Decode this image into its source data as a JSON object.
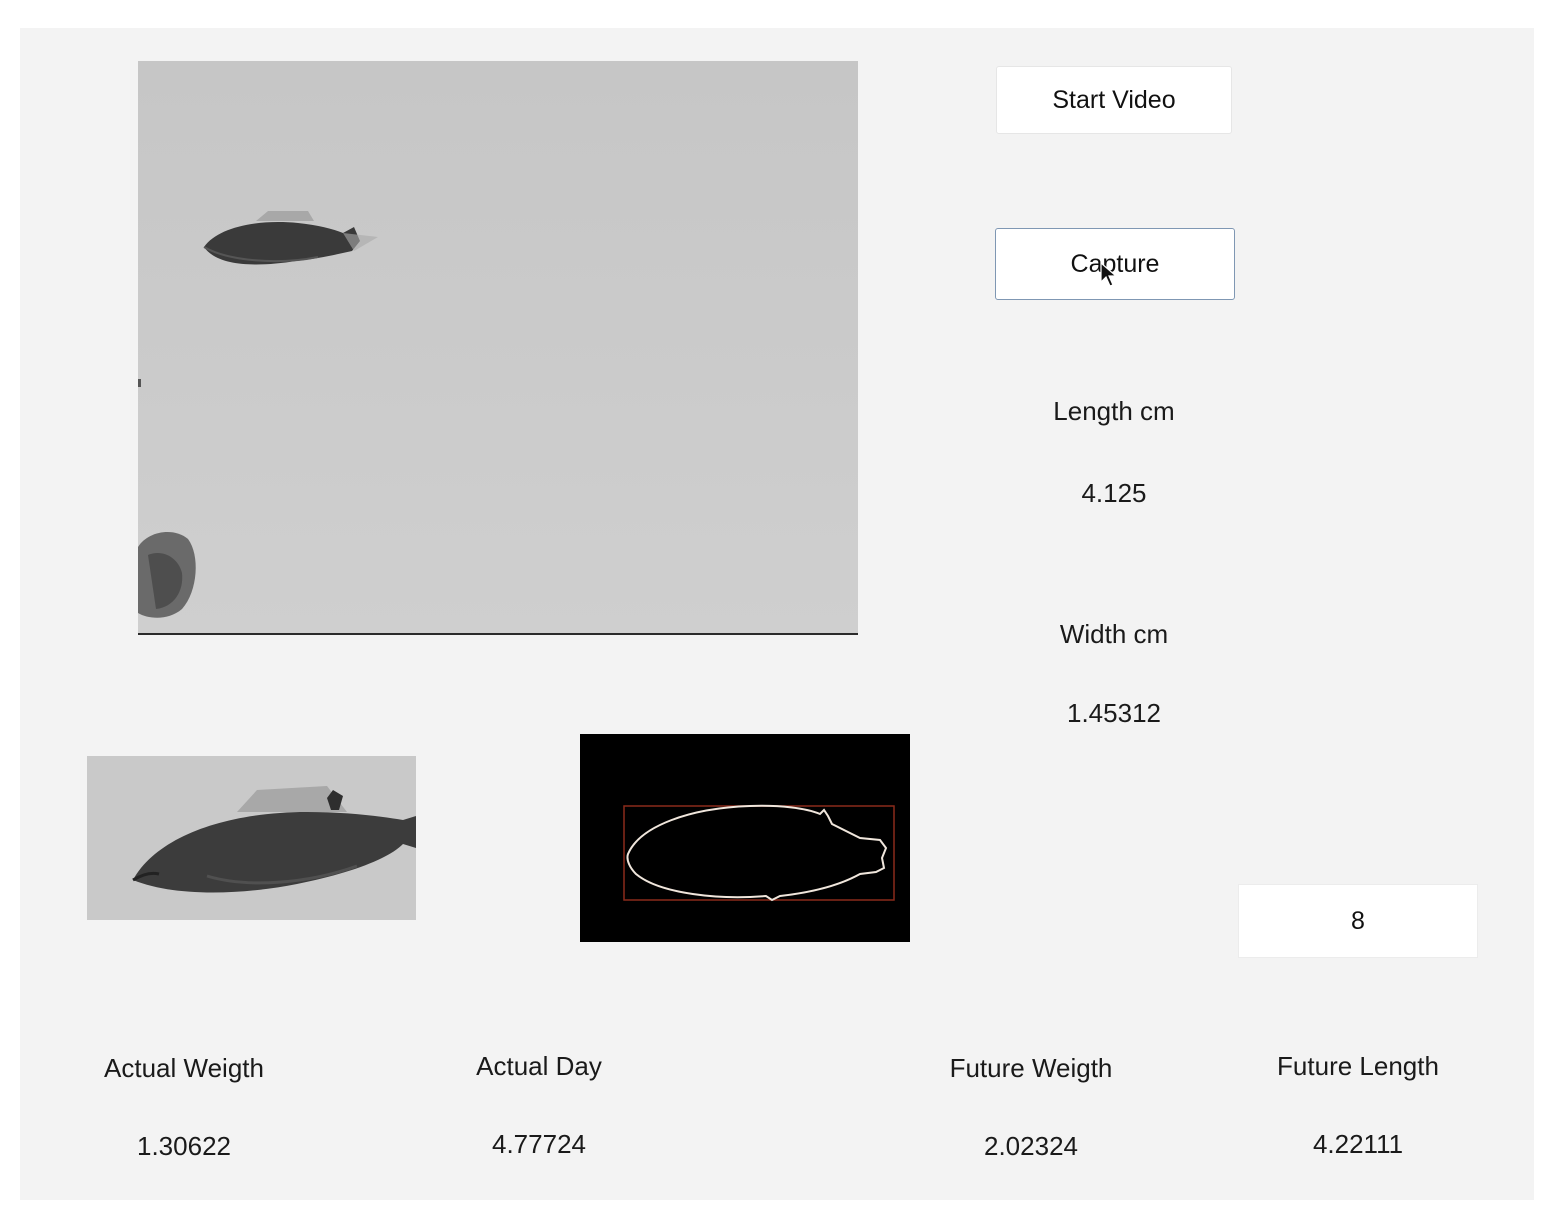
{
  "buttons": {
    "start_video": "Start Video",
    "capture": "Capture"
  },
  "measurements": {
    "length_label": "Length cm",
    "length_value": "4.125",
    "width_label": "Width cm",
    "width_value": "1.45312"
  },
  "day_input": {
    "value": "8"
  },
  "results": {
    "actual_weight_label": "Actual Weigth",
    "actual_weight_value": "1.30622",
    "actual_day_label": "Actual Day",
    "actual_day_value": "4.77724",
    "future_weight_label": "Future Weigth",
    "future_weight_value": "2.02324",
    "future_length_label": "Future Length",
    "future_length_value": "4.22111"
  },
  "colors": {
    "capture_border": "#7f97b3",
    "contour_line": "#f0e6dc",
    "bounding_box": "#8a2a1a"
  }
}
